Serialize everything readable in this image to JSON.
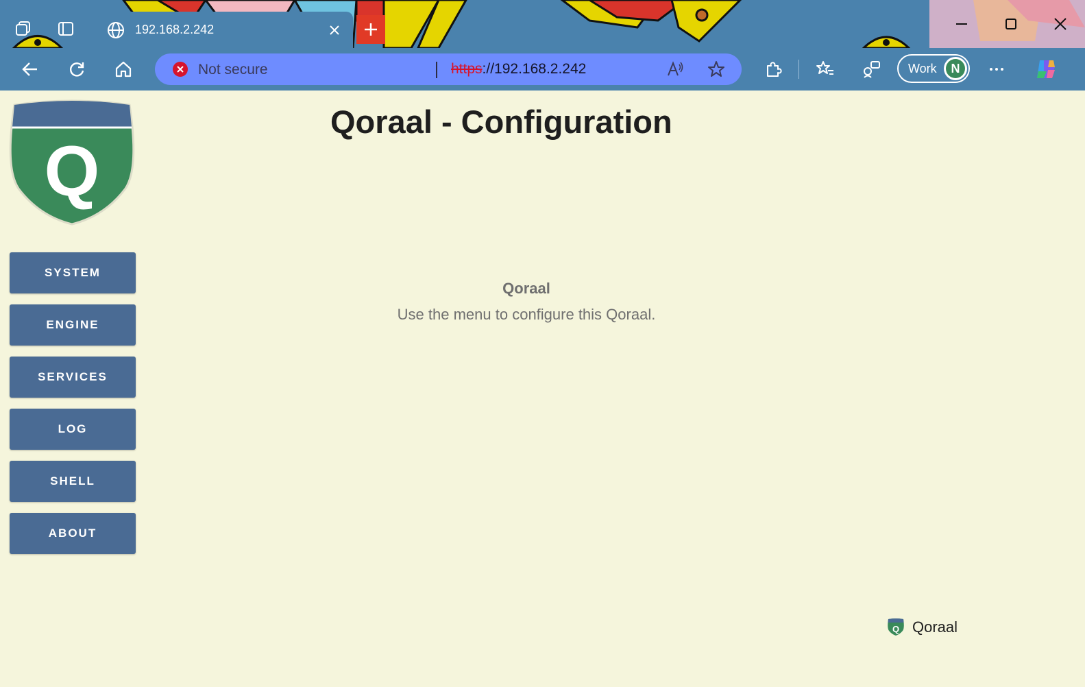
{
  "browser": {
    "tab": {
      "title": "192.168.2.242"
    },
    "address": {
      "security_label": "Not secure",
      "scheme": "https",
      "rest": "://192.168.2.242"
    },
    "profile": {
      "label": "Work",
      "avatar_letter": "N"
    },
    "colors": {
      "frame": "#4a82ad",
      "address_bg": "#6e8cff",
      "new_tab": "#e13a26"
    }
  },
  "page": {
    "title": "Qoraal - Configuration",
    "logo_letter": "Q",
    "nav": [
      {
        "label": "SYSTEM"
      },
      {
        "label": "ENGINE"
      },
      {
        "label": "SERVICES"
      },
      {
        "label": "LOG"
      },
      {
        "label": "SHELL"
      },
      {
        "label": "ABOUT"
      }
    ],
    "welcome": {
      "heading": "Qoraal",
      "text": "Use the menu to configure this Qoraal."
    },
    "footer": {
      "label": "Qoraal"
    },
    "colors": {
      "background": "#f5f5dc",
      "nav_button": "#4a6b94",
      "shield_green": "#3a8a5a",
      "shield_top": "#4a6b94"
    }
  }
}
